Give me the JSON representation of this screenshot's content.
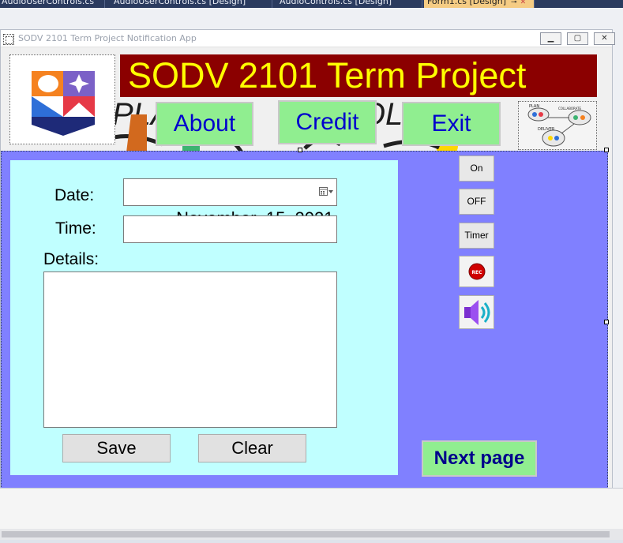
{
  "vs_tabs": [
    {
      "label": "AudioUserControls.cs",
      "active": false
    },
    {
      "label": "AudioUserControls.cs [Design]",
      "active": false
    },
    {
      "label": "AudioControls.cs [Design]",
      "active": false
    },
    {
      "label": "Form1.cs [Design]",
      "active": true
    }
  ],
  "window": {
    "title": "SODV 2101 Term Project Notification App"
  },
  "banner": {
    "title": "SODV 2101 Term Project"
  },
  "nav": {
    "about_label": "About",
    "credit_label": "Credit",
    "exit_label": "Exit"
  },
  "background_art": {
    "fragments": [
      "PLA",
      "COLL"
    ]
  },
  "plan_image": {
    "labels": [
      "PLAN",
      "COLLABORATE",
      "DELIVER"
    ]
  },
  "form": {
    "date_label": "Date:",
    "date_value": "November  15, 2021",
    "time_label": "Time:",
    "time_value": "",
    "details_label": "Details:",
    "details_value": "",
    "save_label": "Save",
    "clear_label": "Clear"
  },
  "side_controls": {
    "on_label": "On",
    "off_label": "OFF",
    "timer_label": "Timer",
    "rec_label": "REC"
  },
  "next_page_label": "Next page",
  "colors": {
    "banner_bg": "#8b0000",
    "banner_text": "#ffff00",
    "nav_bg": "#90ee90",
    "nav_text": "#0000cd",
    "panel_bg": "#8080ff",
    "inner_panel_bg": "#c0ffff"
  }
}
